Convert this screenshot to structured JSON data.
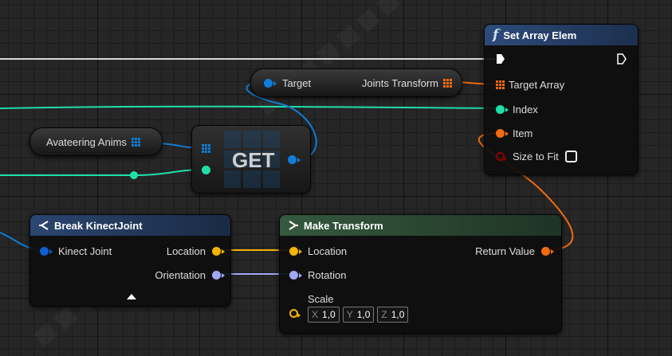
{
  "colors": {
    "exec": "#ffffff",
    "struct": "#f5b400",
    "rotator": "#9fa9f5",
    "transform": "#f06a0f",
    "integer": "#1fdfa9",
    "object": "#0f7ed8",
    "func_header": "#2d4b7a",
    "make_header": "#355a3e",
    "break_header": "#2b4670"
  },
  "set_array_elem": {
    "title": "Set Array Elem",
    "title_icon": "function-icon",
    "exec_in_icon": "exec-in-icon",
    "exec_out_icon": "exec-out-icon",
    "target_array": "Target Array",
    "index": "Index",
    "item": "Item",
    "size_to_fit": "Size to Fit",
    "size_to_fit_checked": false
  },
  "joints_var": {
    "target": "Target",
    "name": "Joints Transform"
  },
  "anims_var": {
    "name": "Avateering Anims"
  },
  "get_node": {
    "label": "GET"
  },
  "break_node": {
    "title": "Break KinectJoint",
    "input": "Kinect Joint",
    "out_location": "Location",
    "out_orientation": "Orientation",
    "expand_icon": "expand-arrow-icon"
  },
  "make_transform": {
    "title": "Make Transform",
    "in_location": "Location",
    "in_rotation": "Rotation",
    "in_scale": "Scale",
    "return_value": "Return Value",
    "scale": {
      "x_label": "X",
      "x": "1,0",
      "y_label": "Y",
      "y": "1,0",
      "z_label": "Z",
      "z": "1,0"
    }
  }
}
